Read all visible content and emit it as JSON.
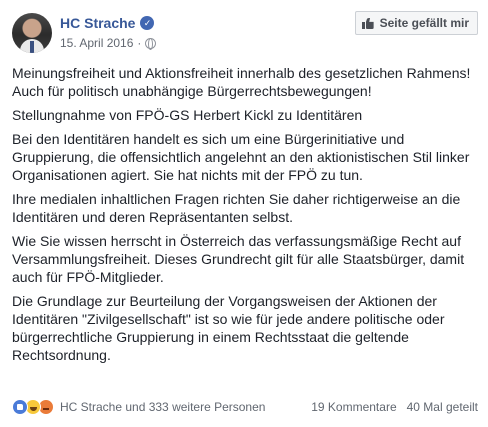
{
  "post": {
    "author": "HC Strache",
    "date": "15. April 2016",
    "date_separator": "·",
    "like_page_label": "Seite gefällt mir",
    "paragraphs": [
      "Meinungsfreiheit und Aktionsfreiheit innerhalb des gesetzlichen Rahmens! Auch für politisch unabhängige Bürgerrechtsbewegungen!",
      "Stellungnahme von FPÖ-GS Herbert Kickl zu Identitären",
      "Bei den Identitären handelt es sich um eine Bürgerinitiative und Gruppierung, die offensichtlich angelehnt an den aktionistischen Stil linker Organisationen agiert. Sie hat nichts mit der FPÖ zu tun.",
      "Ihre medialen inhaltlichen Fragen richten Sie daher richtigerweise an die Identitären und deren Repräsentanten selbst.",
      "Wie Sie wissen herrscht in Österreich das verfassungsmäßige Recht auf Versammlungsfreiheit. Dieses Grundrecht gilt für alle Staatsbürger, damit auch für FPÖ-Mitglieder.",
      "Die Grundlage zur Beurteilung der Vorgangsweisen der Aktionen der Identitären \"Zivilgesellschaft\" ist so wie für jede andere politische oder bürgerrechtliche Gruppierung in einem Rechtsstaat die geltende Rechtsordnung."
    ]
  },
  "footer": {
    "reactions": [
      "like-icon",
      "haha-icon",
      "angry-icon"
    ],
    "reactors": "HC Strache und 333 weitere Personen",
    "comments": "19 Kommentare",
    "shares": "40 Mal geteilt"
  },
  "colors": {
    "link": "#385898",
    "text": "#1d2129",
    "meta": "#616770",
    "like": "#4a7bd8"
  }
}
